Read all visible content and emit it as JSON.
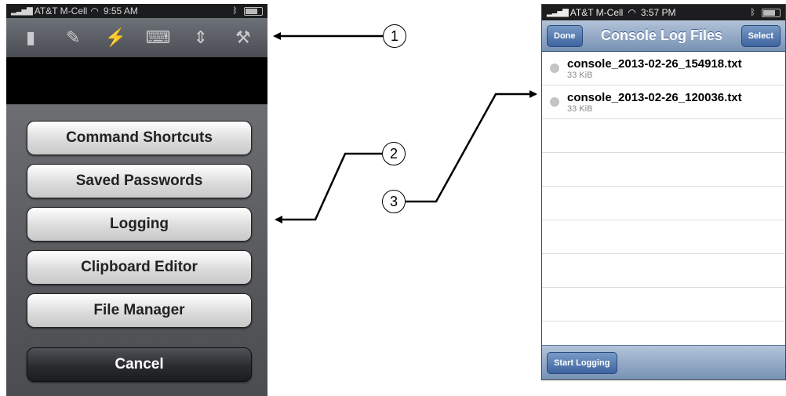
{
  "left_phone": {
    "status_bar": {
      "carrier": "AT&T M-Cell",
      "time": "9:55 AM"
    },
    "toolbar": {
      "icons": [
        "handle-icon",
        "wrench-icon",
        "plug-icon",
        "keyboard-icon",
        "keyboard-updown-icon",
        "utensils-icon"
      ]
    },
    "menu": {
      "command_shortcuts": "Command Shortcuts",
      "saved_passwords": "Saved Passwords",
      "logging": "Logging",
      "clipboard_editor": "Clipboard Editor",
      "file_manager": "File Manager",
      "cancel": "Cancel"
    }
  },
  "right_phone": {
    "status_bar": {
      "carrier": "AT&T M-Cell",
      "time": "3:57 PM"
    },
    "navbar": {
      "done": "Done",
      "title": "Console Log Files",
      "select": "Select"
    },
    "files": [
      {
        "name": "console_2013-02-26_154918.txt",
        "size": "33 KiB"
      },
      {
        "name": "console_2013-02-26_120036.txt",
        "size": "33 KiB"
      }
    ],
    "bottom": {
      "start_logging": "Start Logging"
    }
  },
  "callouts": {
    "c1": "1",
    "c2": "2",
    "c3": "3"
  }
}
